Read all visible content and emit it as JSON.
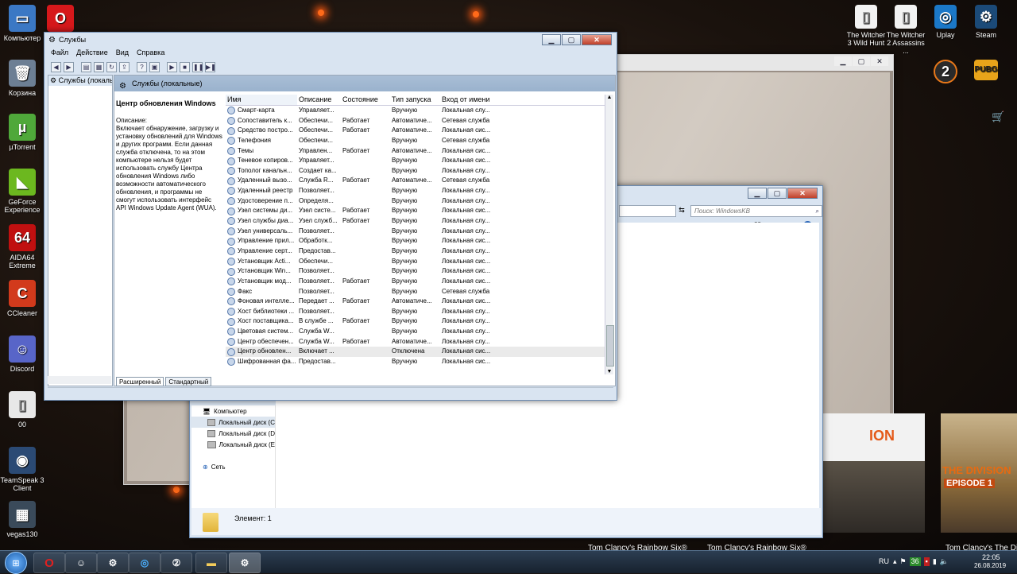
{
  "desktop": {
    "left_icons": [
      {
        "label": "Компьютер",
        "glyph": "▭",
        "color": "#3b78c4"
      },
      {
        "label": "",
        "glyph": "O",
        "color": "#d6181b"
      },
      {
        "label": "Корзина",
        "glyph": "🗑",
        "color": "#6d7f94"
      },
      {
        "label": "µTorrent",
        "glyph": "µ",
        "color": "#4fa83a"
      },
      {
        "label": "GeForce Experience",
        "glyph": "◣",
        "color": "#6cb81f"
      },
      {
        "label": "AIDA64 Extreme",
        "glyph": "64",
        "color": "#c01010"
      },
      {
        "label": "CCleaner",
        "glyph": "C",
        "color": "#d23a1c"
      },
      {
        "label": "Discord",
        "glyph": "☺",
        "color": "#5865c8"
      },
      {
        "label": "00",
        "glyph": "▯",
        "color": "#e8e8e8"
      },
      {
        "label": "TeamSpeak 3 Client",
        "glyph": "◉",
        "color": "#2b4a74"
      },
      {
        "label": "vegas130",
        "glyph": "▦",
        "color": "#3a4a5a"
      }
    ],
    "right_icons": [
      {
        "label": "The Witcher 3 Wild Hunt",
        "glyph": "▯",
        "color": "#f2f2f2"
      },
      {
        "label": "The Witcher 2 Assassins ...",
        "glyph": "▯",
        "color": "#f2f2f2"
      },
      {
        "label": "Uplay",
        "glyph": "◎",
        "color": "#1b78c8"
      },
      {
        "label": "Steam",
        "glyph": "⚙",
        "color": "#1b4a78"
      }
    ],
    "game_captions": [
      "Tom Clancy's Rainbow Six®",
      "Tom Clancy's Rainbow Six®",
      "Tom Clancy's The Divis"
    ],
    "game_tile_text": [
      "ION",
      "THE DIVISION",
      "EPISODE 1"
    ]
  },
  "services_window": {
    "title": "Службы",
    "menu": [
      "Файл",
      "Действие",
      "Вид",
      "Справка"
    ],
    "tree_item": "Службы (локальные)",
    "panel_header": "Службы (локальные)",
    "description": {
      "title": "Центр обновления Windows",
      "label": "Описание:",
      "text": "Включает обнаружение, загрузку и установку обновлений для Windows и других программ. Если данная служба отключена, то на этом компьютере нельзя будет использовать службу Центра обновления Windows либо возможности автоматического обновления, и программы не смогут использовать интерфейс API Windows Update Agent (WUA)."
    },
    "columns": [
      "Имя",
      "Описание",
      "Состояние",
      "Тип запуска",
      "Вход от имени"
    ],
    "rows": [
      [
        "Смарт-карта",
        "Управляет...",
        "",
        "Вручную",
        "Локальная слу..."
      ],
      [
        "Сопоставитель к...",
        "Обеспечи...",
        "Работает",
        "Автоматиче...",
        "Сетевая служба"
      ],
      [
        "Средство постро...",
        "Обеспечи...",
        "Работает",
        "Автоматиче...",
        "Локальная сис..."
      ],
      [
        "Телефония",
        "Обеспечи...",
        "",
        "Вручную",
        "Сетевая служба"
      ],
      [
        "Темы",
        "Управлен...",
        "Работает",
        "Автоматиче...",
        "Локальная сис..."
      ],
      [
        "Теневое копиров...",
        "Управляет...",
        "",
        "Вручную",
        "Локальная сис..."
      ],
      [
        "Тополог канальн...",
        "Создает ка...",
        "",
        "Вручную",
        "Локальная слу..."
      ],
      [
        "Удаленный вызо...",
        "Служба R...",
        "Работает",
        "Автоматиче...",
        "Сетевая служба"
      ],
      [
        "Удаленный реестр",
        "Позволяет...",
        "",
        "Вручную",
        "Локальная слу..."
      ],
      [
        "Удостоверение п...",
        "Определя...",
        "",
        "Вручную",
        "Локальная слу..."
      ],
      [
        "Узел системы ди...",
        "Узел систе...",
        "Работает",
        "Вручную",
        "Локальная сис..."
      ],
      [
        "Узел службы диа...",
        "Узел служб...",
        "Работает",
        "Вручную",
        "Локальная слу..."
      ],
      [
        "Узел универсаль...",
        "Позволяет...",
        "",
        "Вручную",
        "Локальная слу..."
      ],
      [
        "Управление прил...",
        "Обработк...",
        "",
        "Вручную",
        "Локальная сис..."
      ],
      [
        "Управление серт...",
        "Предостав...",
        "",
        "Вручную",
        "Локальная слу..."
      ],
      [
        "Установщик Acti...",
        "Обеспечи...",
        "",
        "Вручную",
        "Локальная сис..."
      ],
      [
        "Установщик Win...",
        "Позволяет...",
        "",
        "Вручную",
        "Локальная сис..."
      ],
      [
        "Установщик мод...",
        "Позволяет...",
        "Работает",
        "Вручную",
        "Локальная сис..."
      ],
      [
        "Факс",
        "Позволяет...",
        "",
        "Вручную",
        "Сетевая служба"
      ],
      [
        "Фоновая интелле...",
        "Передает ...",
        "Работает",
        "Автоматиче...",
        "Локальная сис..."
      ],
      [
        "Хост библиотеки ...",
        "Позволяет...",
        "",
        "Вручную",
        "Локальная слу..."
      ],
      [
        "Хост поставщика...",
        "В службе ...",
        "Работает",
        "Вручную",
        "Локальная слу..."
      ],
      [
        "Цветовая систем...",
        "Служба W...",
        "",
        "Вручную",
        "Локальная слу..."
      ],
      [
        "Центр обеспечен...",
        "Служба W...",
        "Работает",
        "Автоматиче...",
        "Локальная слу..."
      ],
      [
        "Центр обновлен...",
        "Включает ...",
        "",
        "Отключена",
        "Локальная сис..."
      ],
      [
        "Шифрованная фа...",
        "Предостав...",
        "",
        "Вручную",
        "Локальная сис..."
      ]
    ],
    "selected_row": 24,
    "tabs": [
      "Расширенный",
      "Стандартный"
    ]
  },
  "explorer_window": {
    "search_placeholder": "Поиск: WindowsKB",
    "nav": [
      "Компьютер",
      "Локальный диск (C",
      "Локальный диск (D",
      "Локальный диск (E",
      "Сеть"
    ],
    "status": "Элемент: 1"
  },
  "taskbar": {
    "lang": "RU",
    "time": "22:05",
    "date": "26.08.2019"
  }
}
